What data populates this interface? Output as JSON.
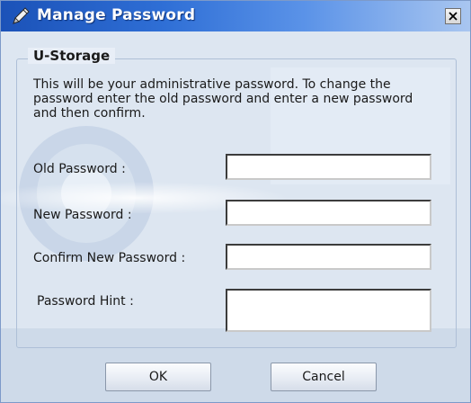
{
  "window": {
    "title": "Manage Password",
    "title_icon": "pencil-icon",
    "close_icon": "close-icon"
  },
  "group": {
    "title": "U-Storage",
    "description": "This will be your administrative password. To change the password enter the old password and enter a new password and then confirm."
  },
  "fields": {
    "old_password": {
      "label": "Old Password :",
      "value": ""
    },
    "new_password": {
      "label": "New Password :",
      "value": ""
    },
    "confirm_password": {
      "label": "Confirm New Password :",
      "value": ""
    },
    "password_hint": {
      "label": "Password Hint :",
      "value": ""
    }
  },
  "buttons": {
    "ok_label": "OK",
    "cancel_label": "Cancel"
  },
  "colors": {
    "titlebar_start": "#1b52b8",
    "titlebar_end": "#a9c6f0",
    "background": "#dfe7f2"
  }
}
